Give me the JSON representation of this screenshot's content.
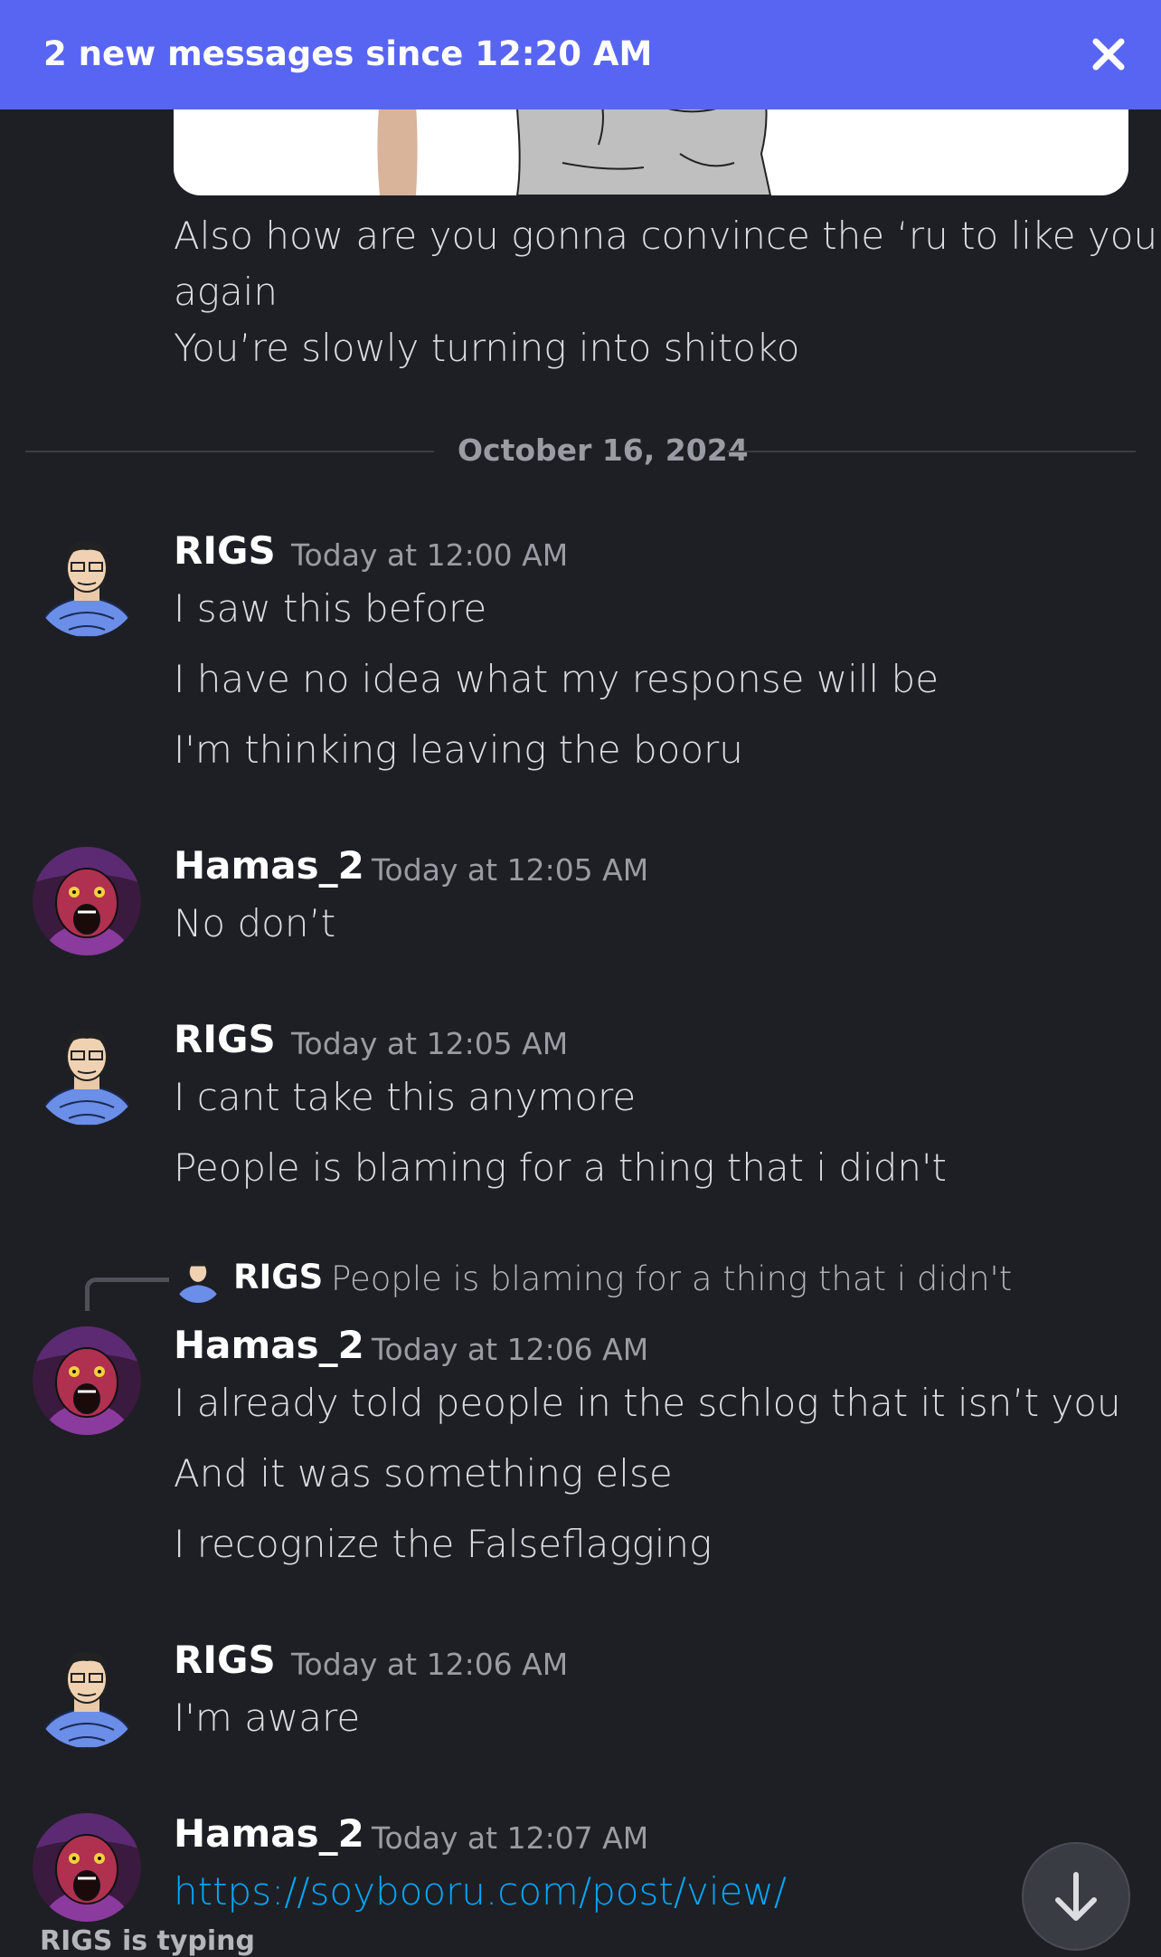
{
  "banner": {
    "text": "2 new messages since 12:20 AM",
    "close_icon": "close-icon"
  },
  "previous_message": {
    "image": "attached-image",
    "lines": [
      "Also how are you gonna convince the ‘ru to like you",
      "again",
      "You’re slowly turning into shitoko"
    ]
  },
  "date_divider": "October 16, 2024",
  "messages": [
    {
      "author": "RIGS",
      "time": "Today at 12:00 AM",
      "avatar": "rigs-avatar",
      "lines": [
        "I saw this before",
        "I have no idea what my response will be",
        "I'm thinking leaving the booru"
      ]
    },
    {
      "author": "Hamas_2",
      "time": "Today at 12:05 AM",
      "avatar": "hamas-avatar",
      "lines": [
        "No don’t"
      ]
    },
    {
      "author": "RIGS",
      "time": "Today at 12:05 AM",
      "avatar": "rigs-avatar",
      "lines": [
        "I cant take this anymore",
        "People is blaming for a thing that i didn't"
      ]
    },
    {
      "author": "Hamas_2",
      "time": "Today at 12:06 AM",
      "avatar": "hamas-avatar",
      "reply": {
        "author": "RIGS",
        "text": "People is blaming for a thing that i didn't"
      },
      "lines": [
        "I already told people in the schlog that it isn’t you",
        "And it was something else",
        "I recognize the Falseflagging"
      ]
    },
    {
      "author": "RIGS",
      "time": "Today at 12:06 AM",
      "avatar": "rigs-avatar",
      "lines": [
        "I'm aware"
      ]
    },
    {
      "author": "Hamas_2",
      "time": "Today at 12:07 AM",
      "avatar": "hamas-avatar",
      "lines": [
        "https://soybooru.com/post/view/"
      ]
    }
  ],
  "typing_indicator": "RIGS is typing",
  "scroll_button_icon": "arrow-down-icon",
  "colors": {
    "banner": "#5865f2",
    "background": "#1e1f24",
    "link": "#00a8fc"
  }
}
